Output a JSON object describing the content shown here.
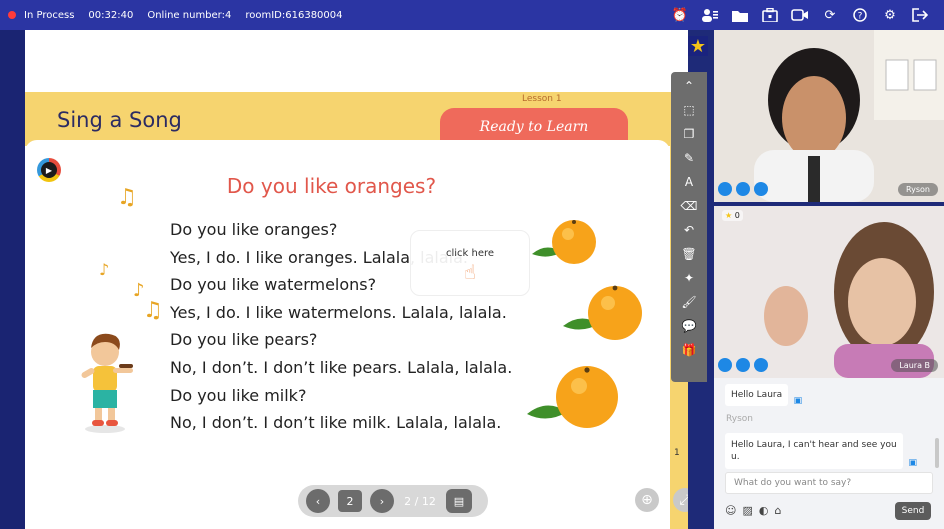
{
  "topbar": {
    "status": "In Process",
    "timer": "00:32:40",
    "online": "Online number:4",
    "room": "roomID:616380004",
    "icons": [
      "alarm-icon",
      "users-icon",
      "folder-icon",
      "toolbox-icon",
      "video-icon",
      "refresh-icon",
      "help-icon",
      "gear-icon",
      "exit-icon"
    ]
  },
  "slide": {
    "header_title": "Sing a Song",
    "lesson": "Lesson 1",
    "ready": "Ready to Learn",
    "song_title": "Do you like oranges?",
    "lyrics": [
      "Do you like oranges?",
      "Yes, I do. I like oranges. Lalala, lalala.",
      "Do you like watermelons?",
      "Yes, I do. I like watermelons. Lalala, lalala.",
      "Do you like pears?",
      "No, I don’t. I don’t like pears. Lalala, lalala.",
      "Do you like milk?",
      "No, I don’t. I don’t like milk. Lalala, lalala."
    ],
    "click_here": "click here",
    "page_badge": "1"
  },
  "pager": {
    "prev": "‹",
    "current": "2",
    "next": "›",
    "total": "2 / 12"
  },
  "videos": {
    "teacher_name": "Ryson",
    "student_name": "Laura B",
    "student_stars": "0"
  },
  "chat": {
    "msg1": "Hello Laura",
    "sender": "Ryson",
    "msg2": "Hello Laura, I can't hear and see you u.",
    "placeholder": "What do you want to say?",
    "send": "Send"
  },
  "colors": {
    "topbar": "#2b35a3",
    "band": "#f6d46f",
    "ready": "#ef6a5b",
    "song_title": "#e1574b",
    "accent": "#1e88e5"
  }
}
